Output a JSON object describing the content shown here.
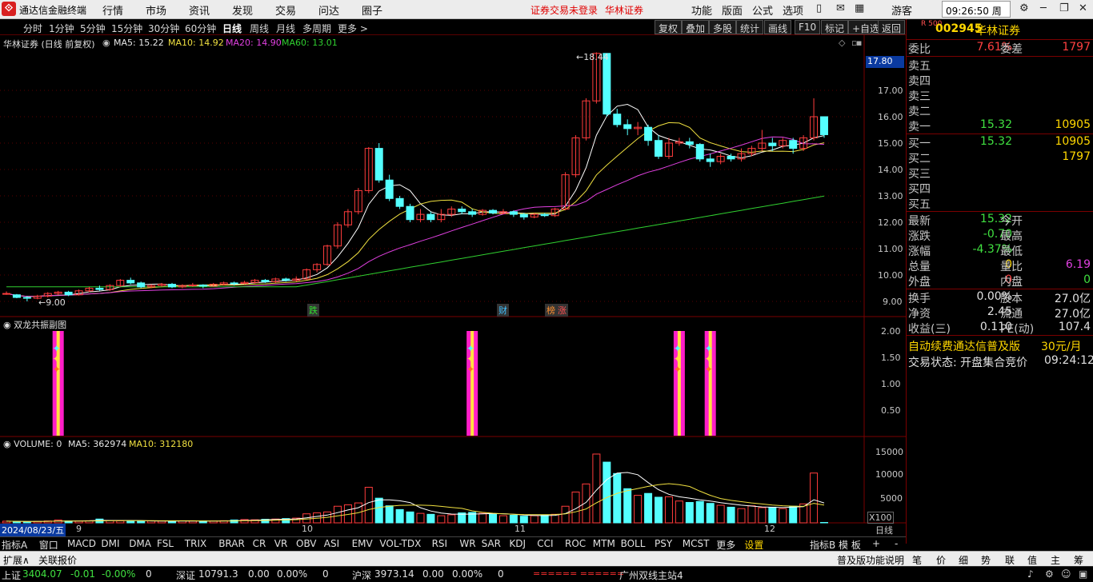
{
  "topbar": {
    "app_name": "通达信金融终端",
    "menus": [
      "行情",
      "市场",
      "资讯",
      "发现",
      "交易",
      "问达",
      "圈子"
    ],
    "login_hint": "证券交易未登录",
    "stock_hint": "华林证券",
    "right_menus": [
      "功能",
      "版面",
      "公式",
      "选项"
    ],
    "user": "游客",
    "clock": "09:26:50 周一"
  },
  "periods": [
    "分时",
    "1分钟",
    "5分钟",
    "15分钟",
    "30分钟",
    "60分钟",
    "日线",
    "周线",
    "月线",
    "多周期",
    "更多 >"
  ],
  "active_period": "日线",
  "toolbar": [
    "复权",
    "叠加",
    "多股",
    "统计",
    "画线",
    "F10",
    "标记",
    "+自选",
    "返回"
  ],
  "main": {
    "title": "华林证券 (日线 前复权)",
    "ma5": "MA5: 15.22",
    "ma10": "MA10: 14.92",
    "ma20": "MA20: 14.90",
    "ma60": "MA60: 13.01",
    "high_mark": "18.44",
    "low_mark": "9.00",
    "current_price": "17.80",
    "y_ticks": [
      "17.00",
      "16.00",
      "15.00",
      "14.00",
      "13.00",
      "12.00",
      "11.00",
      "10.00",
      "9.00"
    ],
    "events": [
      "跌",
      "财",
      "榜",
      "涨"
    ]
  },
  "sub1": {
    "title": "双龙共振副图",
    "y_ticks": [
      "2.00",
      "1.50",
      "1.00",
      "0.50"
    ]
  },
  "sub2": {
    "title": "VOLUME: 0",
    "ma5": "MA5: 362974",
    "ma10": "MA10: 312180",
    "y_ticks": [
      "15000",
      "10000",
      "5000"
    ],
    "unit": "X100"
  },
  "dates": {
    "current": "2024/08/23/五",
    "months": [
      "9",
      "10",
      "11",
      "12"
    ],
    "period": "日线"
  },
  "quote": {
    "code": "002945",
    "name": "华林证券",
    "badge": "R 500",
    "wb_label": "委比",
    "wb": "7.61%",
    "wc_label": "委差",
    "wc": "1797",
    "sell": [
      {
        "l": "卖五",
        "p": "",
        "v": ""
      },
      {
        "l": "卖四",
        "p": "",
        "v": ""
      },
      {
        "l": "卖三",
        "p": "",
        "v": ""
      },
      {
        "l": "卖二",
        "p": "",
        "v": ""
      },
      {
        "l": "卖一",
        "p": "15.32",
        "v": "10905"
      }
    ],
    "buy": [
      {
        "l": "买一",
        "p": "15.32",
        "v": "10905"
      },
      {
        "l": "买二",
        "p": "",
        "v": "1797"
      },
      {
        "l": "买三",
        "p": "",
        "v": ""
      },
      {
        "l": "买四",
        "p": "",
        "v": ""
      },
      {
        "l": "买五",
        "p": "",
        "v": ""
      }
    ],
    "stats": [
      {
        "k": "最新",
        "v": "15.32",
        "k2": "今开",
        "v2": ""
      },
      {
        "k": "涨跌",
        "v": "-0.70",
        "k2": "最高",
        "v2": ""
      },
      {
        "k": "涨幅",
        "v": "-4.37%",
        "k2": "最低",
        "v2": ""
      },
      {
        "k": "总量",
        "v": "0",
        "k2": "量比",
        "v2": "6.19"
      },
      {
        "k": "外盘",
        "v": "0",
        "k2": "内盘",
        "v2": "0"
      }
    ],
    "fund": [
      {
        "k": "换手",
        "v": "0.00%",
        "k2": "股本",
        "v2": "27.0亿"
      },
      {
        "k": "净资",
        "v": "2.45",
        "k2": "流通",
        "v2": "27.0亿"
      },
      {
        "k": "收益(三)",
        "v": "0.110",
        "k2": "PE(动)",
        "v2": "107.4"
      }
    ],
    "ad": "自动续费通达信普及版",
    "ad_price": "30元/月",
    "trade_status": "交易状态: 开盘集合竞价",
    "trade_time": "09:24:12"
  },
  "indicator_tabs": [
    "指标A",
    "窗口",
    "MACD",
    "DMI",
    "DMA",
    "FSL",
    "TRIX",
    "BRAR",
    "CR",
    "VR",
    "OBV",
    "ASI",
    "EMV",
    "VOL-TDX",
    "RSI",
    "WR",
    "SAR",
    "KDJ",
    "CCI",
    "ROC",
    "MTM",
    "BOLL",
    "PSY",
    "MCST",
    "更多",
    "设置"
  ],
  "tabs_right": [
    "指标B",
    "模 板",
    "+",
    "-"
  ],
  "status1": {
    "left": [
      "扩展∧",
      "关联报价"
    ],
    "right": "普及版功能说明",
    "icons": [
      "笔",
      "价",
      "细",
      "势",
      "联",
      "值",
      "主",
      "筹"
    ]
  },
  "status2": {
    "sh": "上证",
    "sh_v": "3404.07",
    "sh_c": "-0.01",
    "sh_p": "-0.00%",
    "sh_n": "0",
    "sz": "深证",
    "sz_v": "10791.3",
    "sz_c": "0.00",
    "sz_p": "0.00%",
    "sz_n": "0",
    "hs": "沪深",
    "hs_v": "3973.14",
    "hs_c": "0.00",
    "hs_p": "0.00%",
    "hs_n": "0",
    "server": "广州双线主站4",
    "marker": "====== ======"
  },
  "chart_data": {
    "type": "candlestick",
    "candles": [
      [
        9.3,
        9.3,
        9.25,
        9.38
      ],
      [
        9.25,
        9.15,
        9.12,
        9.28
      ],
      [
        9.15,
        9.12,
        9.0,
        9.2
      ],
      [
        9.12,
        9.2,
        9.08,
        9.25
      ],
      [
        9.2,
        9.3,
        9.15,
        9.35
      ],
      [
        9.3,
        9.35,
        9.25,
        9.4
      ],
      [
        9.35,
        9.25,
        9.2,
        9.4
      ],
      [
        9.25,
        9.4,
        9.22,
        9.45
      ],
      [
        9.4,
        9.5,
        9.35,
        9.55
      ],
      [
        9.5,
        9.45,
        9.4,
        9.6
      ],
      [
        9.45,
        9.6,
        9.4,
        9.65
      ],
      [
        9.6,
        9.8,
        9.55,
        9.85
      ],
      [
        9.8,
        9.7,
        9.65,
        9.9
      ],
      [
        9.7,
        9.55,
        9.5,
        9.75
      ],
      [
        9.55,
        9.6,
        9.5,
        9.65
      ],
      [
        9.6,
        9.65,
        9.55,
        9.7
      ],
      [
        9.65,
        9.55,
        9.5,
        9.7
      ],
      [
        9.55,
        9.6,
        9.5,
        9.65
      ],
      [
        9.6,
        9.62,
        9.55,
        9.7
      ],
      [
        9.62,
        9.58,
        9.5,
        9.65
      ],
      [
        9.58,
        9.65,
        9.55,
        9.7
      ],
      [
        9.65,
        9.7,
        9.6,
        9.75
      ],
      [
        9.7,
        9.68,
        9.6,
        9.75
      ],
      [
        9.68,
        9.72,
        9.65,
        9.78
      ],
      [
        9.72,
        9.8,
        9.68,
        9.85
      ],
      [
        9.8,
        9.75,
        9.7,
        9.85
      ],
      [
        9.75,
        9.85,
        9.7,
        9.9
      ],
      [
        9.85,
        9.8,
        9.75,
        9.9
      ],
      [
        9.8,
        9.85,
        9.75,
        9.95
      ],
      [
        9.85,
        10.2,
        9.82,
        10.25
      ],
      [
        10.2,
        10.4,
        10.1,
        10.45
      ],
      [
        10.4,
        11.1,
        10.35,
        11.15
      ],
      [
        11.1,
        11.9,
        11.0,
        12.0
      ],
      [
        11.9,
        12.4,
        11.8,
        12.5
      ],
      [
        12.4,
        13.2,
        12.3,
        13.3
      ],
      [
        13.2,
        14.8,
        13.1,
        14.85
      ],
      [
        14.8,
        13.6,
        13.5,
        15.0
      ],
      [
        13.6,
        12.9,
        12.8,
        13.8
      ],
      [
        12.9,
        12.6,
        12.5,
        13.0
      ],
      [
        12.6,
        12.1,
        12.0,
        12.7
      ],
      [
        12.1,
        12.3,
        12.0,
        12.5
      ],
      [
        12.3,
        12.1,
        12.0,
        12.4
      ],
      [
        12.1,
        12.3,
        12.0,
        12.5
      ],
      [
        12.3,
        12.5,
        12.2,
        12.6
      ],
      [
        12.5,
        12.4,
        12.3,
        12.6
      ],
      [
        12.4,
        12.3,
        12.2,
        12.5
      ],
      [
        12.3,
        12.45,
        12.25,
        12.5
      ],
      [
        12.45,
        12.35,
        12.3,
        12.5
      ],
      [
        12.35,
        12.4,
        12.3,
        12.5
      ],
      [
        12.4,
        12.3,
        12.2,
        12.45
      ],
      [
        12.3,
        12.2,
        12.1,
        12.35
      ],
      [
        12.2,
        12.3,
        12.15,
        12.35
      ],
      [
        12.3,
        12.25,
        12.2,
        12.35
      ],
      [
        12.25,
        12.5,
        12.2,
        12.55
      ],
      [
        12.5,
        13.8,
        12.45,
        13.9
      ],
      [
        13.8,
        15.2,
        13.7,
        15.3
      ],
      [
        15.2,
        16.6,
        15.1,
        16.7
      ],
      [
        16.6,
        18.4,
        16.5,
        18.44
      ],
      [
        18.4,
        16.1,
        16.0,
        17.0
      ],
      [
        16.1,
        15.7,
        15.6,
        16.3
      ],
      [
        15.7,
        15.55,
        15.3,
        15.9
      ],
      [
        15.55,
        15.6,
        15.3,
        15.8
      ],
      [
        15.6,
        15.1,
        14.9,
        15.7
      ],
      [
        15.1,
        14.5,
        14.4,
        15.3
      ],
      [
        14.5,
        15.0,
        14.4,
        15.2
      ],
      [
        15.0,
        15.05,
        14.9,
        15.2
      ],
      [
        15.05,
        14.95,
        14.8,
        15.2
      ],
      [
        14.95,
        14.4,
        14.3,
        15.0
      ],
      [
        14.4,
        14.3,
        14.1,
        14.6
      ],
      [
        14.3,
        14.5,
        14.2,
        14.6
      ],
      [
        14.5,
        14.4,
        14.3,
        14.6
      ],
      [
        14.4,
        14.6,
        14.3,
        14.8
      ],
      [
        14.6,
        14.8,
        14.5,
        14.9
      ],
      [
        14.8,
        15.0,
        14.7,
        15.5
      ],
      [
        15.0,
        14.9,
        14.7,
        15.2
      ],
      [
        14.9,
        15.1,
        14.8,
        15.2
      ],
      [
        15.1,
        14.8,
        14.6,
        15.2
      ],
      [
        14.8,
        15.2,
        14.7,
        15.3
      ],
      [
        15.2,
        16.0,
        15.1,
        16.7
      ],
      [
        16.0,
        15.32,
        15.2,
        16.0
      ]
    ],
    "volumes": [
      350,
      300,
      250,
      320,
      400,
      600,
      380,
      360,
      450,
      800,
      500,
      420,
      380,
      360,
      400,
      380,
      350,
      420,
      380,
      400,
      380,
      450,
      600,
      700,
      650,
      750,
      800,
      900,
      1000,
      1900,
      2100,
      2300,
      3500,
      3800,
      4200,
      7500,
      5200,
      3600,
      2800,
      2300,
      2000,
      1800,
      1500,
      1700,
      2100,
      2200,
      2000,
      1800,
      1500,
      1600,
      1400,
      1500,
      1600,
      1800,
      3500,
      6500,
      8200,
      14500,
      12800,
      10400,
      7200,
      5800,
      6200,
      5400,
      5500,
      4600,
      4300,
      4500,
      4100,
      3700,
      3300,
      3000,
      3600,
      3200,
      3300,
      3000,
      3500,
      4000,
      10500,
      0
    ],
    "signals": [
      5,
      45,
      65,
      68
    ]
  }
}
